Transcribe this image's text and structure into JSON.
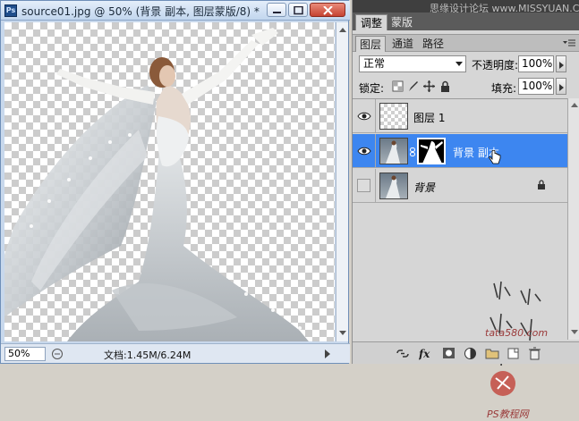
{
  "document": {
    "title": "source01.jpg @ 50% (背景 副本, 图层蒙版/8) *",
    "app_icon_text": "Ps",
    "zoom": "50%",
    "doc_size": "文档:1.45M/6.24M"
  },
  "panels": {
    "top_tabs": [
      "调整",
      "蒙版"
    ],
    "watermark_top": "思缘设计论坛 www.MISSYUAN.COM",
    "layer_tabs": [
      "图层",
      "通道",
      "路径"
    ],
    "blend_mode": "正常",
    "opacity_label": "不透明度:",
    "opacity_value": "100%",
    "lock_label": "锁定:",
    "fill_label": "填充:",
    "fill_value": "100%",
    "layers": [
      {
        "name": "图层 1",
        "visible": true,
        "selected": false
      },
      {
        "name": "背景 副本",
        "visible": true,
        "selected": true
      },
      {
        "name": "背景",
        "visible": false,
        "selected": false,
        "locked": true
      }
    ],
    "watermark_site": "PS教程网",
    "watermark_url": "tata580.com"
  },
  "colors": {
    "selection": "#3d86f0",
    "title_bar": "#c2d6ee",
    "panel_bg": "#d6d6d6"
  }
}
